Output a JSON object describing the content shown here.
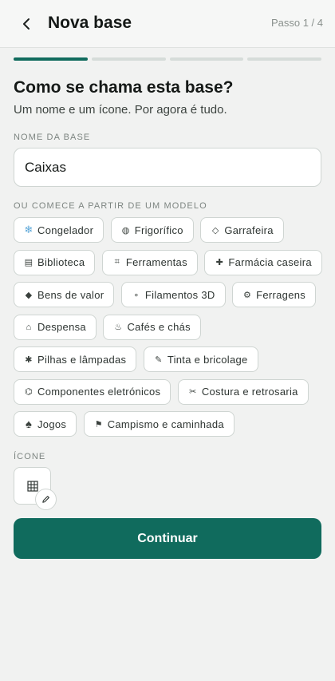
{
  "header": {
    "title": "Nova base",
    "step": "Passo 1 / 4",
    "back_icon": "chevron-left-icon"
  },
  "progress": {
    "total_steps": 4,
    "current_step": 1
  },
  "form": {
    "heading": "Como se chama esta base?",
    "subheading": "Um nome e um ícone. Por agora é tudo.",
    "name_label": "NOME DA BASE",
    "name_value": "Caixas",
    "templates_label": "OU COMECE A PARTIR DE UM MODELO",
    "icon_label": "ÍCONE",
    "selected_icon": "grid-icon"
  },
  "templates": [
    {
      "icon": "❄",
      "icon_name": "snowflake-icon",
      "label": "Congelador"
    },
    {
      "icon": "◍",
      "icon_name": "fridge-icon",
      "label": "Frigorífico"
    },
    {
      "icon": "◇",
      "icon_name": "bottle-icon",
      "label": "Garrafeira"
    },
    {
      "icon": "▤",
      "icon_name": "books-icon",
      "label": "Biblioteca"
    },
    {
      "icon": "⌗",
      "icon_name": "tools-icon",
      "label": "Ferramentas"
    },
    {
      "icon": "✚",
      "icon_name": "pharmacy-icon",
      "label": "Farmácia caseira"
    },
    {
      "icon": "◆",
      "icon_name": "diamond-icon",
      "label": "Bens de valor"
    },
    {
      "icon": "∘",
      "icon_name": "filament-icon",
      "label": "Filamentos 3D"
    },
    {
      "icon": "⚙",
      "icon_name": "gear-icon",
      "label": "Ferragens"
    },
    {
      "icon": "⌂",
      "icon_name": "pantry-icon",
      "label": "Despensa"
    },
    {
      "icon": "♨",
      "icon_name": "coffee-icon",
      "label": "Cafés e chás"
    },
    {
      "icon": "✱",
      "icon_name": "battery-icon",
      "label": "Pilhas e lâmpadas"
    },
    {
      "icon": "✎",
      "icon_name": "paint-icon",
      "label": "Tinta e bricolage"
    },
    {
      "icon": "⌬",
      "icon_name": "chip-icon",
      "label": "Componentes eletrónicos"
    },
    {
      "icon": "✂",
      "icon_name": "scissors-icon",
      "label": "Costura e retrosaria"
    },
    {
      "icon": "♠",
      "icon_name": "spade-icon",
      "label": "Jogos"
    },
    {
      "icon": "⚑",
      "icon_name": "flag-icon",
      "label": "Campismo e caminhada"
    }
  ],
  "actions": {
    "continue_label": "Continuar"
  },
  "colors": {
    "accent": "#106b5d",
    "background": "#f1f2f1",
    "border": "#cfd5d2"
  }
}
